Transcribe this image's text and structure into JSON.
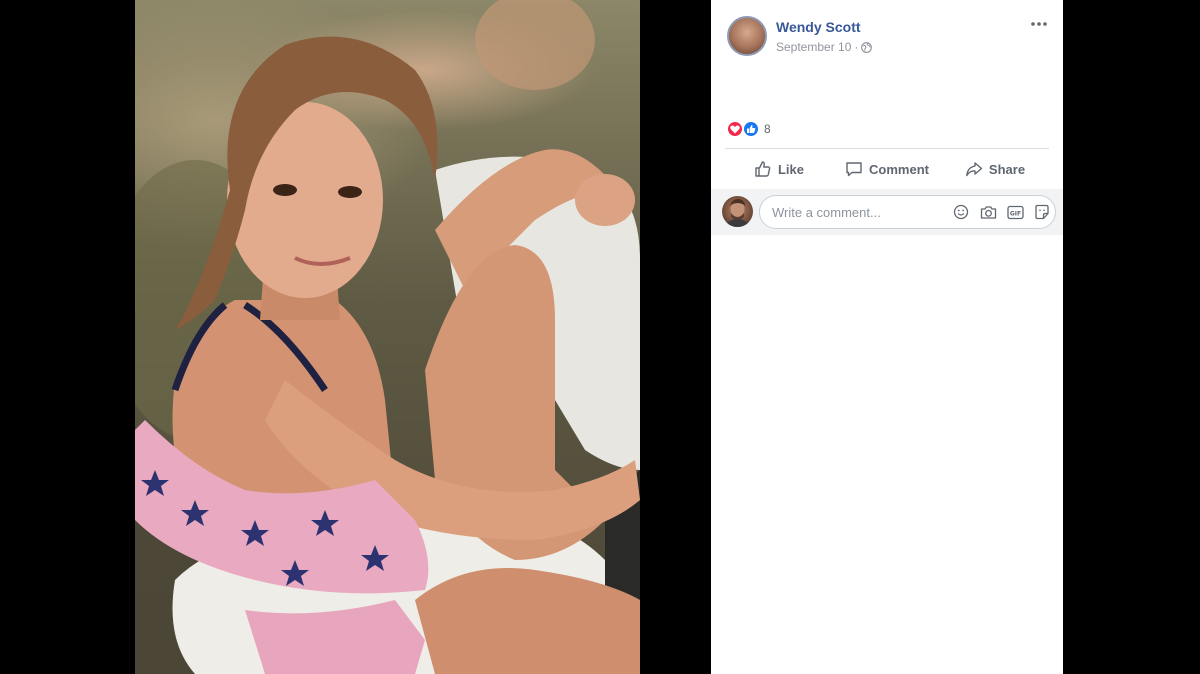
{
  "post": {
    "author": "Wendy Scott",
    "date": "September 10",
    "separator": "·",
    "privacy_icon": "globe-icon",
    "reaction_count": "8",
    "reactions": [
      "love-icon",
      "like-icon"
    ]
  },
  "actions": {
    "like_label": "Like",
    "comment_label": "Comment",
    "share_label": "Share"
  },
  "comment": {
    "placeholder": "Write a comment...",
    "tools": [
      "emoji-icon",
      "camera-icon",
      "gif-icon",
      "sticker-icon"
    ]
  },
  "colors": {
    "author_link": "#385898",
    "meta_text": "#90949c",
    "action_text": "#606770",
    "love": "#f0284a",
    "like": "#1877f2",
    "comment_bar": "#f2f3f5"
  }
}
